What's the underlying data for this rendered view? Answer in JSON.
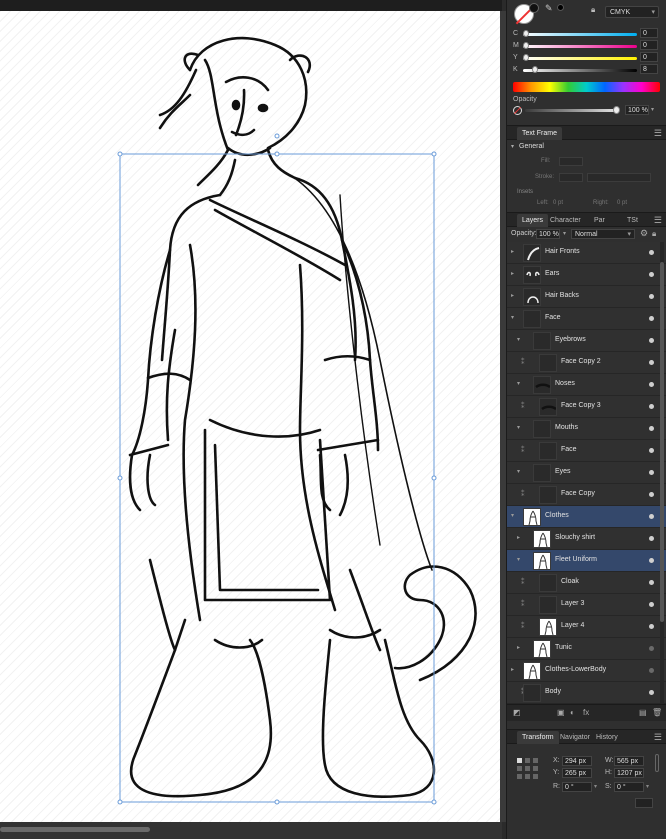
{
  "color_panel": {
    "color_mode": "CMYK",
    "channels": [
      {
        "label": "C",
        "value": "0",
        "fraction": 0.0,
        "gradient": "linear-gradient(90deg,#ffffff,#00aeef)"
      },
      {
        "label": "M",
        "value": "0",
        "fraction": 0.0,
        "gradient": "linear-gradient(90deg,#ffffff,#ec008c)"
      },
      {
        "label": "Y",
        "value": "0",
        "fraction": 0.0,
        "gradient": "linear-gradient(90deg,#ffffff,#fff200)"
      },
      {
        "label": "K",
        "value": "8",
        "fraction": 0.08,
        "gradient": "linear-gradient(90deg,#ffffff,#000000)"
      }
    ],
    "opacity_label": "Opacity",
    "opacity_value": "100 %"
  },
  "text_frame_panel": {
    "tab": "Text Frame",
    "section": "General",
    "fill_label": "Fill:",
    "stroke_label": "Stroke:",
    "insets_label": "Insets",
    "left_label": "Left:",
    "left_value": "0 pt",
    "right_label": "Right:",
    "right_value": "0 pt"
  },
  "layers_panel": {
    "tabs": [
      "Layers",
      "Character",
      "Par",
      "TSt"
    ],
    "opacity_label": "Opacity:",
    "opacity_value": "100 %",
    "blend_mode": "Normal",
    "layers": [
      {
        "name": "Hair Fronts",
        "indent": 0,
        "expander": "▸",
        "thumb": "hair-fronts",
        "selected": false,
        "mask": false,
        "visible": true
      },
      {
        "name": "Ears",
        "indent": 0,
        "expander": "▸",
        "thumb": "ears",
        "selected": false,
        "mask": false,
        "visible": true
      },
      {
        "name": "Hair Backs",
        "indent": 0,
        "expander": "▸",
        "thumb": "hair-backs",
        "selected": false,
        "mask": false,
        "visible": true
      },
      {
        "name": "Face",
        "indent": 0,
        "expander": "▾",
        "thumb": "blank",
        "selected": false,
        "mask": false,
        "visible": true
      },
      {
        "name": "Eyebrows",
        "indent": 1,
        "expander": "▾",
        "thumb": "blank",
        "selected": false,
        "mask": false,
        "visible": true
      },
      {
        "name": "Face Copy 2",
        "indent": 2,
        "expander": "",
        "thumb": "blank",
        "selected": false,
        "mask": true,
        "visible": true
      },
      {
        "name": "Noses",
        "indent": 1,
        "expander": "▾",
        "thumb": "nose",
        "selected": false,
        "mask": false,
        "visible": true
      },
      {
        "name": "Face Copy 3",
        "indent": 2,
        "expander": "",
        "thumb": "nose",
        "selected": false,
        "mask": true,
        "visible": true
      },
      {
        "name": "Mouths",
        "indent": 1,
        "expander": "▾",
        "thumb": "blank",
        "selected": false,
        "mask": false,
        "visible": true
      },
      {
        "name": "Face",
        "indent": 2,
        "expander": "",
        "thumb": "blank",
        "selected": false,
        "mask": true,
        "visible": true
      },
      {
        "name": "Eyes",
        "indent": 1,
        "expander": "▾",
        "thumb": "blank",
        "selected": false,
        "mask": false,
        "visible": true
      },
      {
        "name": "Face Copy",
        "indent": 2,
        "expander": "",
        "thumb": "blank",
        "selected": false,
        "mask": true,
        "visible": true
      },
      {
        "name": "Clothes",
        "indent": 0,
        "expander": "▾",
        "thumb": "figure",
        "selected": true,
        "mask": false,
        "visible": true
      },
      {
        "name": "Slouchy shirt",
        "indent": 1,
        "expander": "▸",
        "thumb": "figure",
        "selected": false,
        "mask": false,
        "visible": true
      },
      {
        "name": "Fleet Uniform",
        "indent": 1,
        "expander": "▾",
        "thumb": "figure",
        "selected": true,
        "mask": false,
        "visible": true
      },
      {
        "name": "Cloak",
        "indent": 2,
        "expander": "",
        "thumb": "blank",
        "selected": false,
        "mask": true,
        "visible": true
      },
      {
        "name": "Layer 3",
        "indent": 2,
        "expander": "",
        "thumb": "blank",
        "selected": false,
        "mask": true,
        "visible": true
      },
      {
        "name": "Layer 4",
        "indent": 2,
        "expander": "",
        "thumb": "figure",
        "selected": false,
        "mask": true,
        "visible": true
      },
      {
        "name": "Tunic",
        "indent": 1,
        "expander": "▸",
        "thumb": "figure",
        "selected": false,
        "mask": false,
        "visible": false
      },
      {
        "name": "Clothes-LowerBody",
        "indent": 0,
        "expander": "▸",
        "thumb": "figure",
        "selected": false,
        "mask": false,
        "visible": false
      },
      {
        "name": "Body",
        "indent": 0,
        "expander": "",
        "thumb": "blank",
        "selected": false,
        "mask": true,
        "visible": true
      }
    ]
  },
  "transform_panel": {
    "tabs": [
      "Transform",
      "Navigator",
      "History"
    ],
    "x_label": "X:",
    "x_value": "294 px",
    "y_label": "Y:",
    "y_value": "265 px",
    "w_label": "W:",
    "w_value": "565 px",
    "h_label": "H:",
    "h_value": "1207 px",
    "r_label": "R:",
    "r_value": "0 °",
    "s_label": "S:",
    "s_value": "0 °"
  },
  "colors": {
    "panel_bg": "#2f2f2f",
    "selected_row": "#34486b",
    "selection_box": "#6a9bd8"
  }
}
